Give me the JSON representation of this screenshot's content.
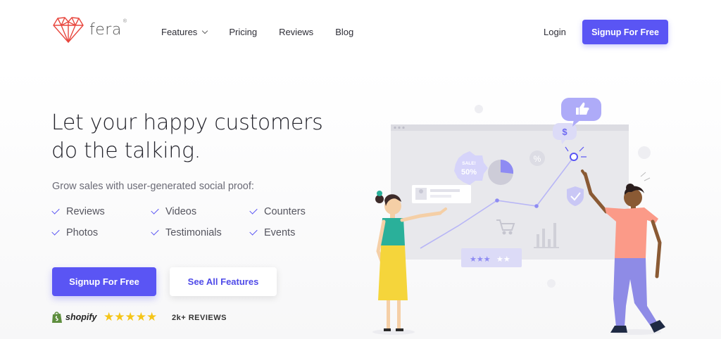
{
  "brand": {
    "name": "fera",
    "tm": "®"
  },
  "nav": {
    "links": [
      {
        "label": "Features",
        "has_dropdown": true
      },
      {
        "label": "Pricing"
      },
      {
        "label": "Reviews"
      },
      {
        "label": "Blog"
      }
    ],
    "login_label": "Login",
    "signup_label": "Signup For Free"
  },
  "hero": {
    "headline_line1": "Let your happy customers",
    "headline_line2": "do the talking.",
    "subhead": "Grow sales with user-generated social proof:",
    "features": [
      "Reviews",
      "Videos",
      "Counters",
      "Photos",
      "Testimonials",
      "Events"
    ],
    "primary_cta": "Signup For Free",
    "secondary_cta": "See All Features"
  },
  "social_proof": {
    "platform": "shopify",
    "rating_stars": 5,
    "reviews_label": "2k+ REVIEWS"
  },
  "illustration": {
    "sale_badge_line1": "SALE!",
    "sale_badge_line2": "50%"
  },
  "colors": {
    "accent": "#5a55f4",
    "star": "#f5c518",
    "logo": "#e8473e"
  }
}
